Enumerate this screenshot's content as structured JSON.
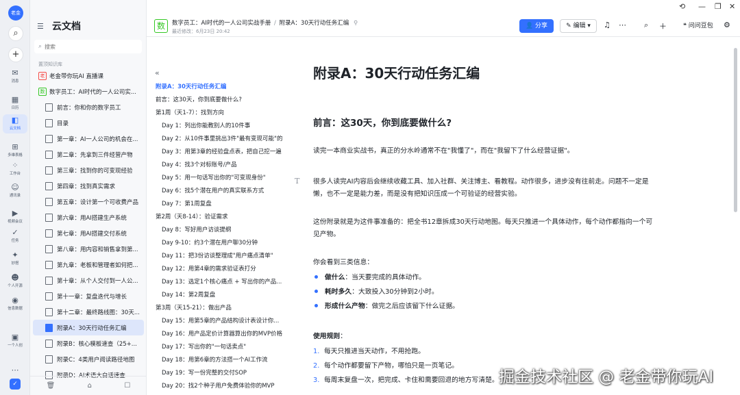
{
  "rail": {
    "avatar": "老金",
    "items": [
      {
        "icon": "✉",
        "label": "消息"
      },
      {
        "icon": "▦",
        "label": "日历"
      },
      {
        "icon": "◧",
        "label": "云文档"
      },
      {
        "icon": "⊞",
        "label": "多维表格"
      },
      {
        "icon": "⁘",
        "label": "工作台"
      },
      {
        "icon": "☺",
        "label": "通讯录"
      },
      {
        "icon": "▶",
        "label": "视频会议"
      },
      {
        "icon": "✓",
        "label": "任务"
      },
      {
        "icon": "✦",
        "label": "妙搭"
      },
      {
        "icon": "☻",
        "label": "个人开源"
      },
      {
        "icon": "◉",
        "label": "信息数据"
      },
      {
        "icon": "▣",
        "label": "一个人创"
      }
    ],
    "more": "⋯"
  },
  "sidebar": {
    "title": "云文档",
    "search_placeholder": "搜索",
    "section": "置顶知识库",
    "items": [
      {
        "label": "老金带你玩AI 直播课",
        "badge": "老"
      },
      {
        "label": "数字员工：AI时代的一人公司实...",
        "badge": "数"
      },
      {
        "label": "前言：你和你的数字员工"
      },
      {
        "label": "目录"
      },
      {
        "label": "第一章：AI一人公司的机会在..."
      },
      {
        "label": "第二章：先拿到三件经营产物"
      },
      {
        "label": "第三章：找到你的可变现经验"
      },
      {
        "label": "第四章：找到真实需求"
      },
      {
        "label": "第五章：设计第一个可收费产品"
      },
      {
        "label": "第六章：用AI搭建生产系统"
      },
      {
        "label": "第七章：用AI搭建交付系统"
      },
      {
        "label": "第八章：用内容和销售拿到第..."
      },
      {
        "label": "第九章：老板和管理者如何把..."
      },
      {
        "label": "第十章：从个人交付到一人公..."
      },
      {
        "label": "第十一章：复盘迭代与增长"
      },
      {
        "label": "第十二章：最终路线图：30天..."
      },
      {
        "label": "附录A：30天行动任务汇编"
      },
      {
        "label": "附录B：核心模板速查（25+..."
      },
      {
        "label": "附录C：4类用户阅读路径地图"
      },
      {
        "label": "附录D：AI术语大白话速查"
      }
    ],
    "bottom_icons": [
      "🗑",
      "⌂",
      "☐"
    ]
  },
  "header": {
    "badge": "数",
    "crumb_parent": "数字员工：AI时代的一人公司实战手册",
    "crumb_sep": "/",
    "crumb_current": "附录A：30天行动任务汇编",
    "pin_icon": "⚲",
    "last_modified": "最近修改：6月23日 20:42",
    "share": "分享",
    "edit": "编辑",
    "ask": "问问豆包"
  },
  "outline": {
    "collapse": "«",
    "items": [
      {
        "text": "附录A：30天行动任务汇编",
        "lvl": "h1",
        "active": true
      },
      {
        "text": "前言：这30天，你到底要做什么?",
        "lvl": "h1"
      },
      {
        "text": "第1周（天1-7）：找到方向",
        "lvl": "h1"
      },
      {
        "text": "Day 1：列出你能教别人的10件事",
        "lvl": "h2"
      },
      {
        "text": "Day 2：从10件事里挑出3件\"最有变现可能\"的",
        "lvl": "h2"
      },
      {
        "text": "Day 3：用第3章的经验盘点表，把自己挖一遍",
        "lvl": "h2"
      },
      {
        "text": "Day 4：找3个对标账号/产品",
        "lvl": "h2"
      },
      {
        "text": "Day 5：用一句话写出你的\"可变现身份\"",
        "lvl": "h2"
      },
      {
        "text": "Day 6：找5个潜在用户的真实联系方式",
        "lvl": "h2"
      },
      {
        "text": "Day 7：第1周复盘",
        "lvl": "h2"
      },
      {
        "text": "第2周（天8-14）：验证需求",
        "lvl": "h1"
      },
      {
        "text": "Day 8：写好用户访谈提纲",
        "lvl": "h2"
      },
      {
        "text": "Day 9-10：约3个潜在用户聊30分钟",
        "lvl": "h2"
      },
      {
        "text": "Day 11：把3份访谈整理成\"用户痛点清单\"",
        "lvl": "h2"
      },
      {
        "text": "Day 12：用第4章的需求验证表打分",
        "lvl": "h2"
      },
      {
        "text": "Day 13：选定1个核心痛点 + 写出你的产品...",
        "lvl": "h2"
      },
      {
        "text": "Day 14：第2周复盘",
        "lvl": "h2"
      },
      {
        "text": "第3周（天15-21）：做出产品",
        "lvl": "h1"
      },
      {
        "text": "Day 15：用第5章的产品结构设计表设计你...",
        "lvl": "h2"
      },
      {
        "text": "Day 16：用产品定价计算器算出你的MVP价格",
        "lvl": "h2"
      },
      {
        "text": "Day 17：写出你的\"一句话卖点\"",
        "lvl": "h2"
      },
      {
        "text": "Day 18：用第6章的方法搭一个AI工作流",
        "lvl": "h2"
      },
      {
        "text": "Day 19：写一份完整的交付SOP",
        "lvl": "h2"
      },
      {
        "text": "Day 20：找2个种子用户免费体验你的MVP",
        "lvl": "h2"
      }
    ]
  },
  "doc": {
    "title": "附录A：30天行动任务汇编",
    "h_intro": "前言：这30天，你到底要做什么?",
    "p1": "读完一本商业实战书，真正的分水岭通常不在\"我懂了\"，而在\"我留下了什么经营证据\"。",
    "p2a": "很多人读完AI内容后会继续收藏工具、加入社群、关注博主、看教程。动作很多，进步没有往前走。问题不一定是",
    "p2b": "懒，也不一定是能力差，而是没有把知识压成一个可验证的经营实验。",
    "p3a": "这份附录就是为这件事准备的：把全书12章拆成30天行动地图。每天只推进一个具体动作，每个动作都指向一个可",
    "p3b": "见产物。",
    "p4": "你会看到三类信息：",
    "bullets": [
      {
        "label": "做什么",
        "text": "：当天要完成的具体动作。"
      },
      {
        "label": "耗时多久",
        "text": "：大致投入30分钟到2小时。"
      },
      {
        "label": "形成什么产物",
        "text": "：做完之后应该留下什么证据。"
      }
    ],
    "rules_title": "使用规则",
    "rules_colon": "：",
    "rules": [
      {
        "n": "1.",
        "text": "每天只推进当天动作，不用抢跑。"
      },
      {
        "n": "2.",
        "text": "每个动作都要留下产物，哪怕只是一页笔记。"
      },
      {
        "n": "3.",
        "text": "每周末复盘一次，把完成、卡住和需要回退的地方写清楚。"
      }
    ]
  },
  "watermark": "掘金技术社区 @ 老金带你玩AI",
  "colors": {
    "accent": "#3370ff",
    "badge_green": "#34c724",
    "badge_red": "#f54a45"
  }
}
